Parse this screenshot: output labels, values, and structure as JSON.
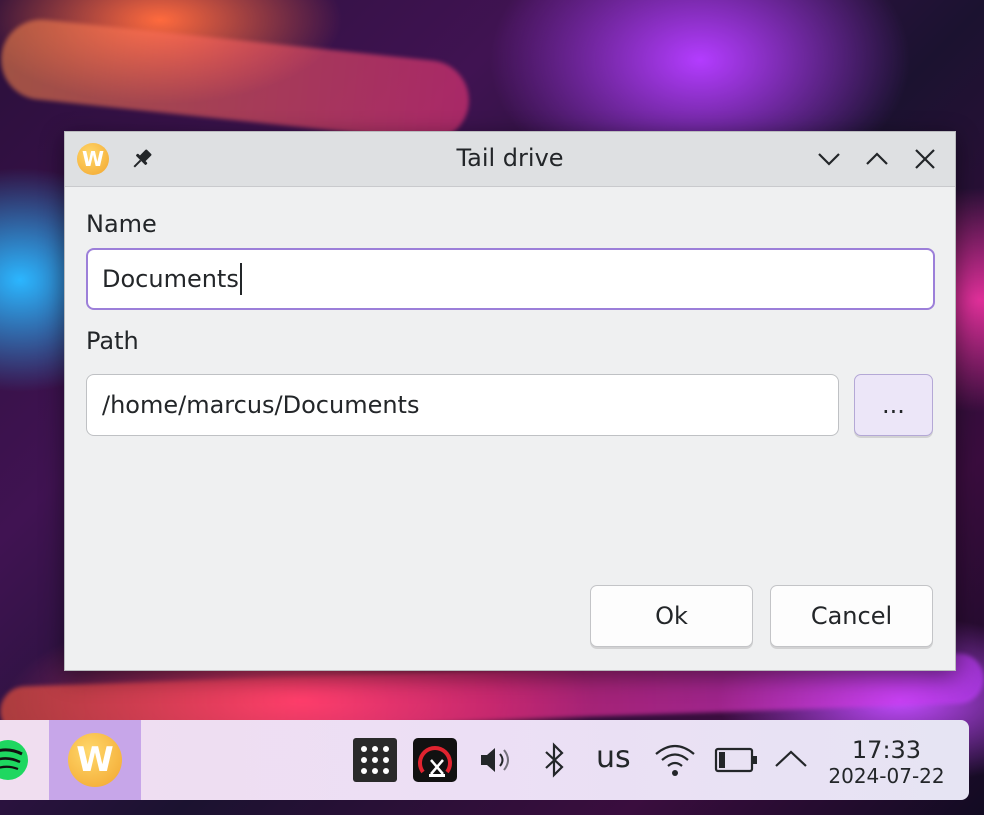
{
  "dialog": {
    "title": "Tail drive",
    "name_label": "Name",
    "name_value": "Documents",
    "path_label": "Path",
    "path_value": "/home/marcus/Documents",
    "browse_label": "...",
    "ok_label": "Ok",
    "cancel_label": "Cancel",
    "icons": [
      "app-icon",
      "pin-icon",
      "minimize-icon",
      "maximize-icon",
      "close-icon"
    ]
  },
  "taskbar": {
    "tasks": [
      "spotify-icon",
      "app-icon"
    ],
    "tray": [
      "grid-app-icon",
      "speedometer-app-icon",
      "volume-icon",
      "bluetooth-icon",
      "wifi-icon",
      "battery-icon",
      "expand-tray-icon"
    ],
    "keyboard_layout": "us",
    "time": "17:33",
    "date": "2024-07-22"
  },
  "colors": {
    "focus_border": "#9c7fd9",
    "active_task": "#c7a6e9",
    "accent_button": "#ece6f8"
  }
}
